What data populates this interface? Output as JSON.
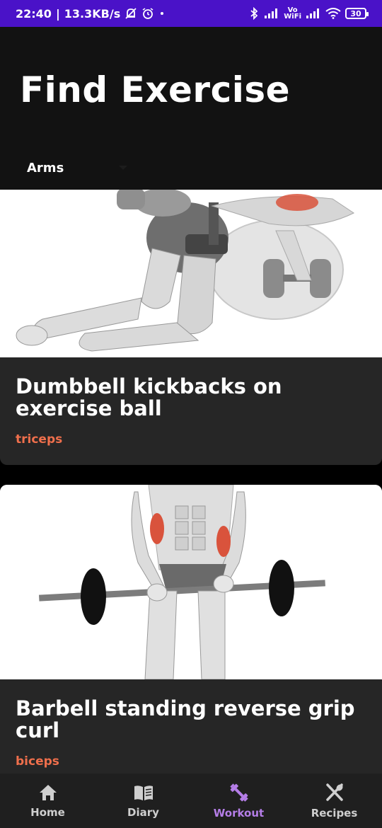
{
  "status_bar": {
    "time": "22:40",
    "speed": "13.3KB/s",
    "battery": "30",
    "icons": [
      "mute-icon",
      "alarm-icon",
      "dot-icon",
      "bluetooth-icon",
      "signal-icon",
      "vowifi-icon",
      "signal-icon",
      "wifi-icon",
      "battery-icon"
    ],
    "vowifi_top": "Vo",
    "vowifi_bottom": "WiFi"
  },
  "header": {
    "title": "Find Exercise",
    "filter": {
      "selected": "Arms"
    }
  },
  "exercises": [
    {
      "title": "Dumbbell kickbacks on exercise ball",
      "muscle": "triceps"
    },
    {
      "title": "Barbell standing reverse grip curl",
      "muscle": "biceps"
    }
  ],
  "bottom_nav": {
    "items": [
      {
        "label": "Home",
        "icon": "home-icon"
      },
      {
        "label": "Diary",
        "icon": "book-icon"
      },
      {
        "label": "Workout",
        "icon": "dumbbell-icon",
        "active": true
      },
      {
        "label": "Recipes",
        "icon": "utensils-icon"
      }
    ]
  },
  "colors": {
    "status_bar": "#4a12c8",
    "accent": "#b57ee8",
    "muscle_tag": "#ef6f4c",
    "card": "#262626"
  }
}
